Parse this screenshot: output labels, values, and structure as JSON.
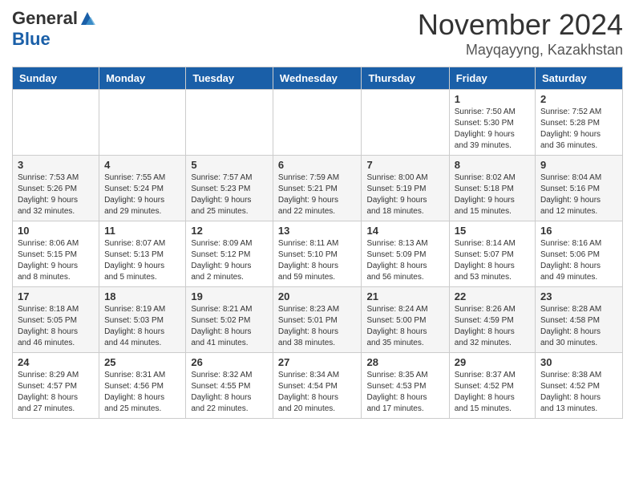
{
  "header": {
    "logo_general": "General",
    "logo_blue": "Blue",
    "month_title": "November 2024",
    "location": "Mayqayyng, Kazakhstan"
  },
  "weekdays": [
    "Sunday",
    "Monday",
    "Tuesday",
    "Wednesday",
    "Thursday",
    "Friday",
    "Saturday"
  ],
  "weeks": [
    [
      {
        "day": "",
        "info": ""
      },
      {
        "day": "",
        "info": ""
      },
      {
        "day": "",
        "info": ""
      },
      {
        "day": "",
        "info": ""
      },
      {
        "day": "",
        "info": ""
      },
      {
        "day": "1",
        "info": "Sunrise: 7:50 AM\nSunset: 5:30 PM\nDaylight: 9 hours\nand 39 minutes."
      },
      {
        "day": "2",
        "info": "Sunrise: 7:52 AM\nSunset: 5:28 PM\nDaylight: 9 hours\nand 36 minutes."
      }
    ],
    [
      {
        "day": "3",
        "info": "Sunrise: 7:53 AM\nSunset: 5:26 PM\nDaylight: 9 hours\nand 32 minutes."
      },
      {
        "day": "4",
        "info": "Sunrise: 7:55 AM\nSunset: 5:24 PM\nDaylight: 9 hours\nand 29 minutes."
      },
      {
        "day": "5",
        "info": "Sunrise: 7:57 AM\nSunset: 5:23 PM\nDaylight: 9 hours\nand 25 minutes."
      },
      {
        "day": "6",
        "info": "Sunrise: 7:59 AM\nSunset: 5:21 PM\nDaylight: 9 hours\nand 22 minutes."
      },
      {
        "day": "7",
        "info": "Sunrise: 8:00 AM\nSunset: 5:19 PM\nDaylight: 9 hours\nand 18 minutes."
      },
      {
        "day": "8",
        "info": "Sunrise: 8:02 AM\nSunset: 5:18 PM\nDaylight: 9 hours\nand 15 minutes."
      },
      {
        "day": "9",
        "info": "Sunrise: 8:04 AM\nSunset: 5:16 PM\nDaylight: 9 hours\nand 12 minutes."
      }
    ],
    [
      {
        "day": "10",
        "info": "Sunrise: 8:06 AM\nSunset: 5:15 PM\nDaylight: 9 hours\nand 8 minutes."
      },
      {
        "day": "11",
        "info": "Sunrise: 8:07 AM\nSunset: 5:13 PM\nDaylight: 9 hours\nand 5 minutes."
      },
      {
        "day": "12",
        "info": "Sunrise: 8:09 AM\nSunset: 5:12 PM\nDaylight: 9 hours\nand 2 minutes."
      },
      {
        "day": "13",
        "info": "Sunrise: 8:11 AM\nSunset: 5:10 PM\nDaylight: 8 hours\nand 59 minutes."
      },
      {
        "day": "14",
        "info": "Sunrise: 8:13 AM\nSunset: 5:09 PM\nDaylight: 8 hours\nand 56 minutes."
      },
      {
        "day": "15",
        "info": "Sunrise: 8:14 AM\nSunset: 5:07 PM\nDaylight: 8 hours\nand 53 minutes."
      },
      {
        "day": "16",
        "info": "Sunrise: 8:16 AM\nSunset: 5:06 PM\nDaylight: 8 hours\nand 49 minutes."
      }
    ],
    [
      {
        "day": "17",
        "info": "Sunrise: 8:18 AM\nSunset: 5:05 PM\nDaylight: 8 hours\nand 46 minutes."
      },
      {
        "day": "18",
        "info": "Sunrise: 8:19 AM\nSunset: 5:03 PM\nDaylight: 8 hours\nand 44 minutes."
      },
      {
        "day": "19",
        "info": "Sunrise: 8:21 AM\nSunset: 5:02 PM\nDaylight: 8 hours\nand 41 minutes."
      },
      {
        "day": "20",
        "info": "Sunrise: 8:23 AM\nSunset: 5:01 PM\nDaylight: 8 hours\nand 38 minutes."
      },
      {
        "day": "21",
        "info": "Sunrise: 8:24 AM\nSunset: 5:00 PM\nDaylight: 8 hours\nand 35 minutes."
      },
      {
        "day": "22",
        "info": "Sunrise: 8:26 AM\nSunset: 4:59 PM\nDaylight: 8 hours\nand 32 minutes."
      },
      {
        "day": "23",
        "info": "Sunrise: 8:28 AM\nSunset: 4:58 PM\nDaylight: 8 hours\nand 30 minutes."
      }
    ],
    [
      {
        "day": "24",
        "info": "Sunrise: 8:29 AM\nSunset: 4:57 PM\nDaylight: 8 hours\nand 27 minutes."
      },
      {
        "day": "25",
        "info": "Sunrise: 8:31 AM\nSunset: 4:56 PM\nDaylight: 8 hours\nand 25 minutes."
      },
      {
        "day": "26",
        "info": "Sunrise: 8:32 AM\nSunset: 4:55 PM\nDaylight: 8 hours\nand 22 minutes."
      },
      {
        "day": "27",
        "info": "Sunrise: 8:34 AM\nSunset: 4:54 PM\nDaylight: 8 hours\nand 20 minutes."
      },
      {
        "day": "28",
        "info": "Sunrise: 8:35 AM\nSunset: 4:53 PM\nDaylight: 8 hours\nand 17 minutes."
      },
      {
        "day": "29",
        "info": "Sunrise: 8:37 AM\nSunset: 4:52 PM\nDaylight: 8 hours\nand 15 minutes."
      },
      {
        "day": "30",
        "info": "Sunrise: 8:38 AM\nSunset: 4:52 PM\nDaylight: 8 hours\nand 13 minutes."
      }
    ]
  ]
}
